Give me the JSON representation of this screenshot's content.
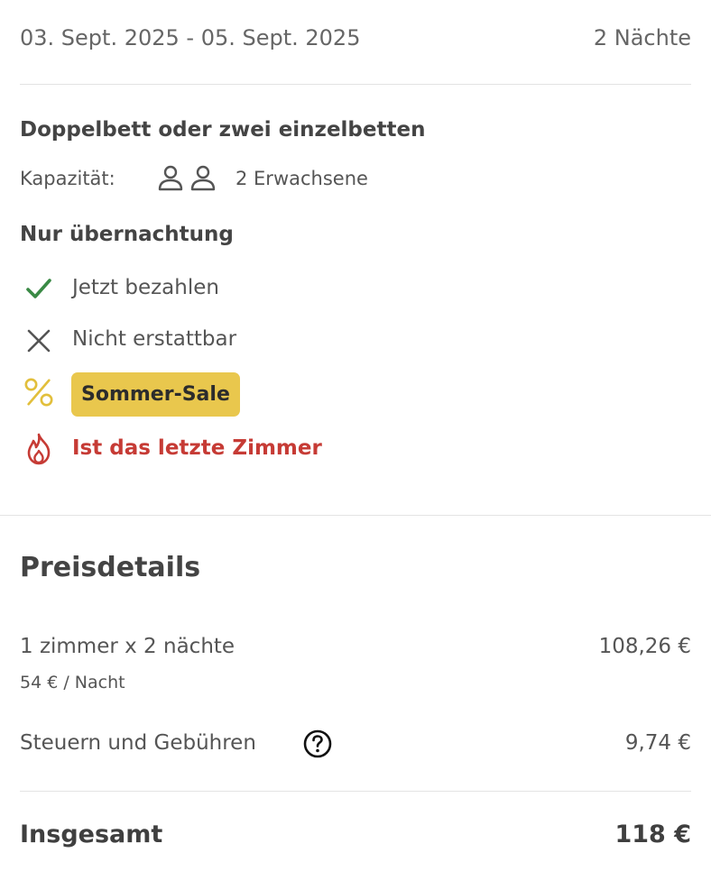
{
  "booking": {
    "dates": "03. Sept. 2025 - 05. Sept. 2025",
    "nights": "2 Nächte"
  },
  "room": {
    "title": "Doppelbett oder zwei einzelbetten",
    "capacity_label": "Kapazität:",
    "capacity_value": "2 Erwachsene",
    "capacity_icon": "two-persons-icon"
  },
  "rate": {
    "board": "Nur übernachtung",
    "features": [
      {
        "icon": "check-icon",
        "label": "Jetzt bezahlen",
        "color": "#3a8a45"
      },
      {
        "icon": "x-icon",
        "label": "Nicht erstattbar",
        "color": "#555555"
      }
    ],
    "promo": {
      "icon": "percent-icon",
      "label": "Sommer-Sale",
      "color": "#e9c74d"
    },
    "urgency": {
      "icon": "flame-icon",
      "label": "Ist das letzte Zimmer",
      "color": "#c63b35"
    }
  },
  "price_details": {
    "title": "Preisdetails",
    "rooms_line": {
      "label": "1 zimmer x 2 nächte",
      "value": "108,26 €",
      "sub": "54 € / Nacht"
    },
    "taxes_line": {
      "label": "Steuern und Gebühren",
      "value": "9,74 €",
      "help_icon": "question-circle-icon"
    },
    "total": {
      "label": "Insgesamt",
      "value": "118 €"
    }
  }
}
